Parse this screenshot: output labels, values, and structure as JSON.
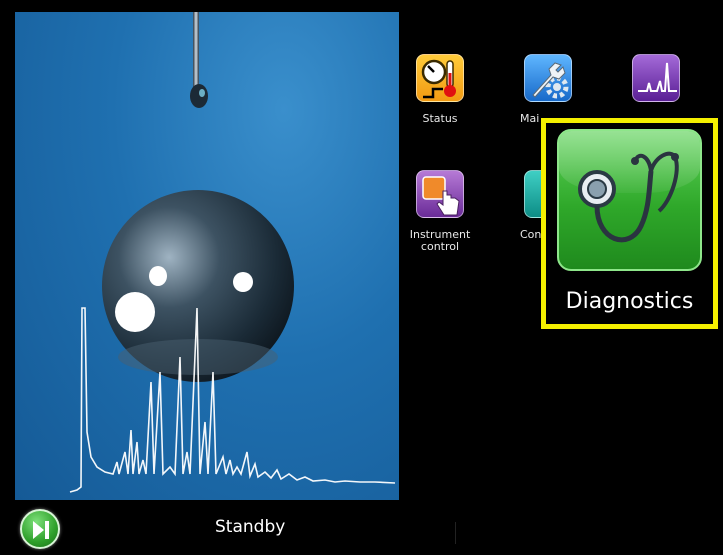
{
  "apps": {
    "status": {
      "label": "Status",
      "icon": "status-gauge-thermometer-icon"
    },
    "maintenance": {
      "label": "Mai",
      "icon": "wrench-gear-icon"
    },
    "spectra": {
      "label": "",
      "icon": "spectrum-peaks-icon"
    },
    "instrument_control": {
      "label": "Instrument control",
      "icon": "hand-touch-icon"
    },
    "communication": {
      "label": "Con",
      "icon": "teal-app-icon"
    }
  },
  "diagnostics": {
    "label": "Diagnostics",
    "icon": "stethoscope-icon",
    "highlight_color": "#f5f000"
  },
  "statusbar": {
    "state": "Standby",
    "action_icon": "play-skip-icon"
  },
  "colors": {
    "background": "#000000",
    "hero_blue": "#1f70b0",
    "accent_green": "#2fa82a"
  }
}
